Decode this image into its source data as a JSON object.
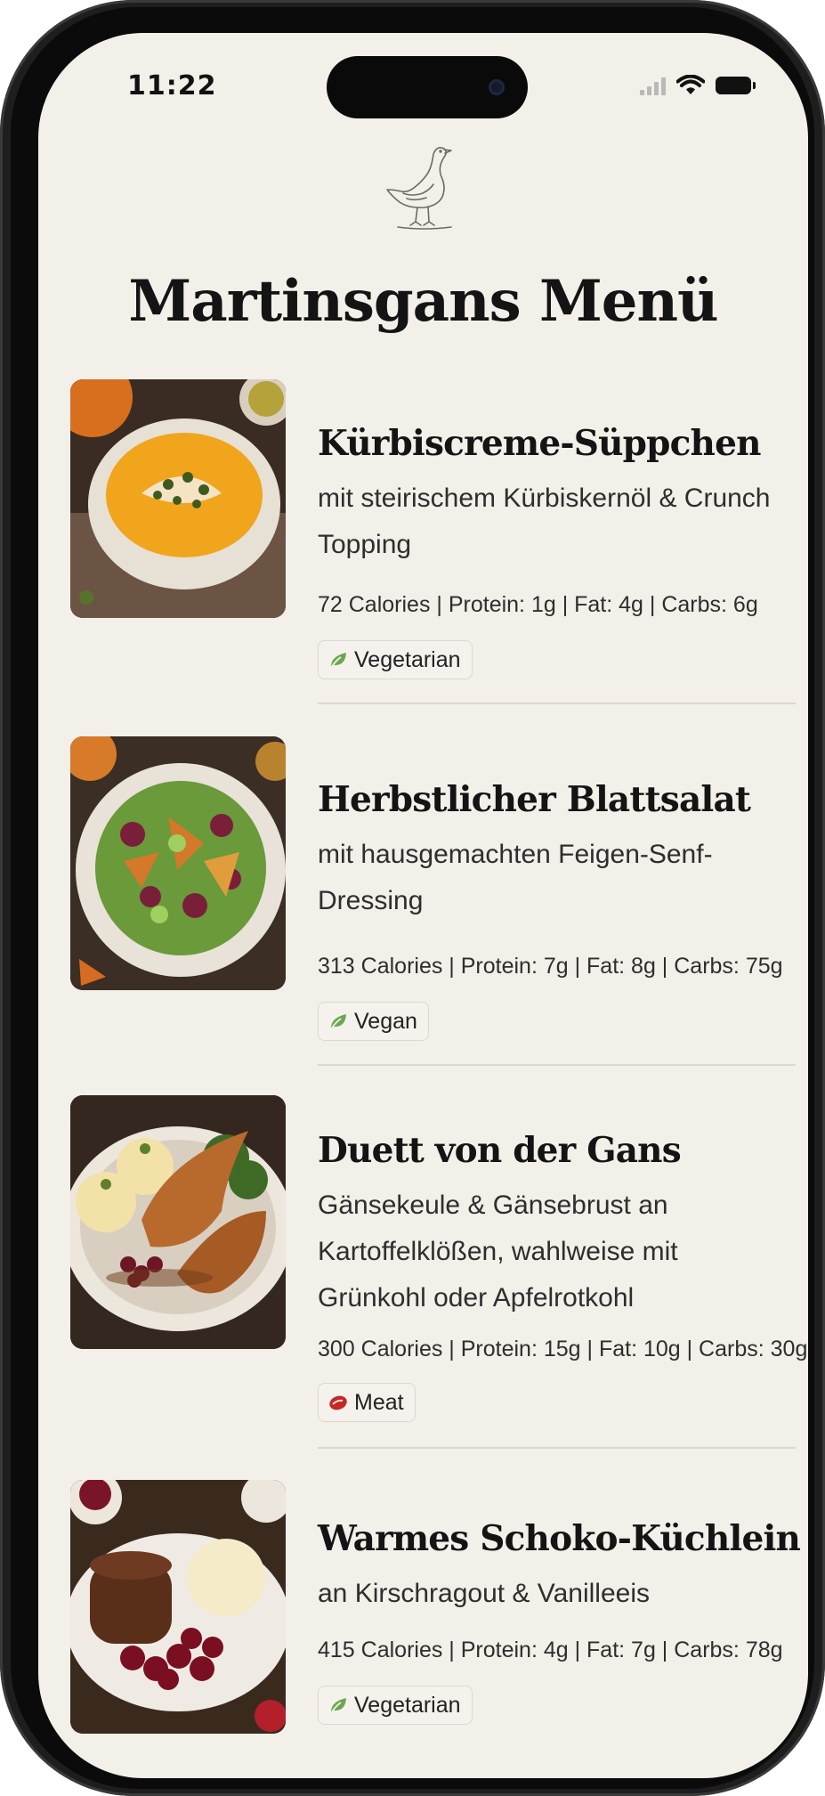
{
  "status_bar": {
    "time": "11:22"
  },
  "header": {
    "title": "Martinsgans Menü",
    "logo_icon": "goose-icon"
  },
  "menu": {
    "items": [
      {
        "name": "Kürbiscreme-Süppchen",
        "description": "mit steirischem Kürbiskernöl & Crunch Topping",
        "nutrition": "72 Calories | Protein: 1g | Fat: 4g | Carbs: 6g",
        "tag": "Vegetarian",
        "tag_icon": "leaf-icon",
        "featured": false
      },
      {
        "name": "Herbstlicher Blattsalat",
        "description": "mit hausgemachten Feigen-Senf-Dressing",
        "nutrition": "313 Calories | Protein: 7g | Fat: 8g | Carbs: 75g",
        "tag": "Vegan",
        "tag_icon": "leaf-icon",
        "featured": false
      },
      {
        "name": "Duett von der Gans",
        "description": "Gänsekeule & Gänsebrust an Kartoffelklößen, wahlweise mit Grünkohl oder Apfelrotkohl",
        "nutrition": "300 Calories | Protein: 15g | Fat: 10g | Carbs: 30g",
        "tag": "Meat",
        "tag_icon": "meat-icon",
        "featured": true
      },
      {
        "name": "Warmes Schoko-Küchlein",
        "description": "an Kirschragout & Vanilleeis",
        "nutrition": "415 Calories | Protein: 4g | Fat: 7g | Carbs: 78g",
        "tag": "Vegetarian",
        "tag_icon": "leaf-icon",
        "featured": false
      }
    ]
  },
  "colors": {
    "background": "#f3efe9",
    "text": "#141414",
    "leaf_green": "#6aa84f",
    "meat_red": "#c62828",
    "star_blue": "#1d4a72"
  }
}
